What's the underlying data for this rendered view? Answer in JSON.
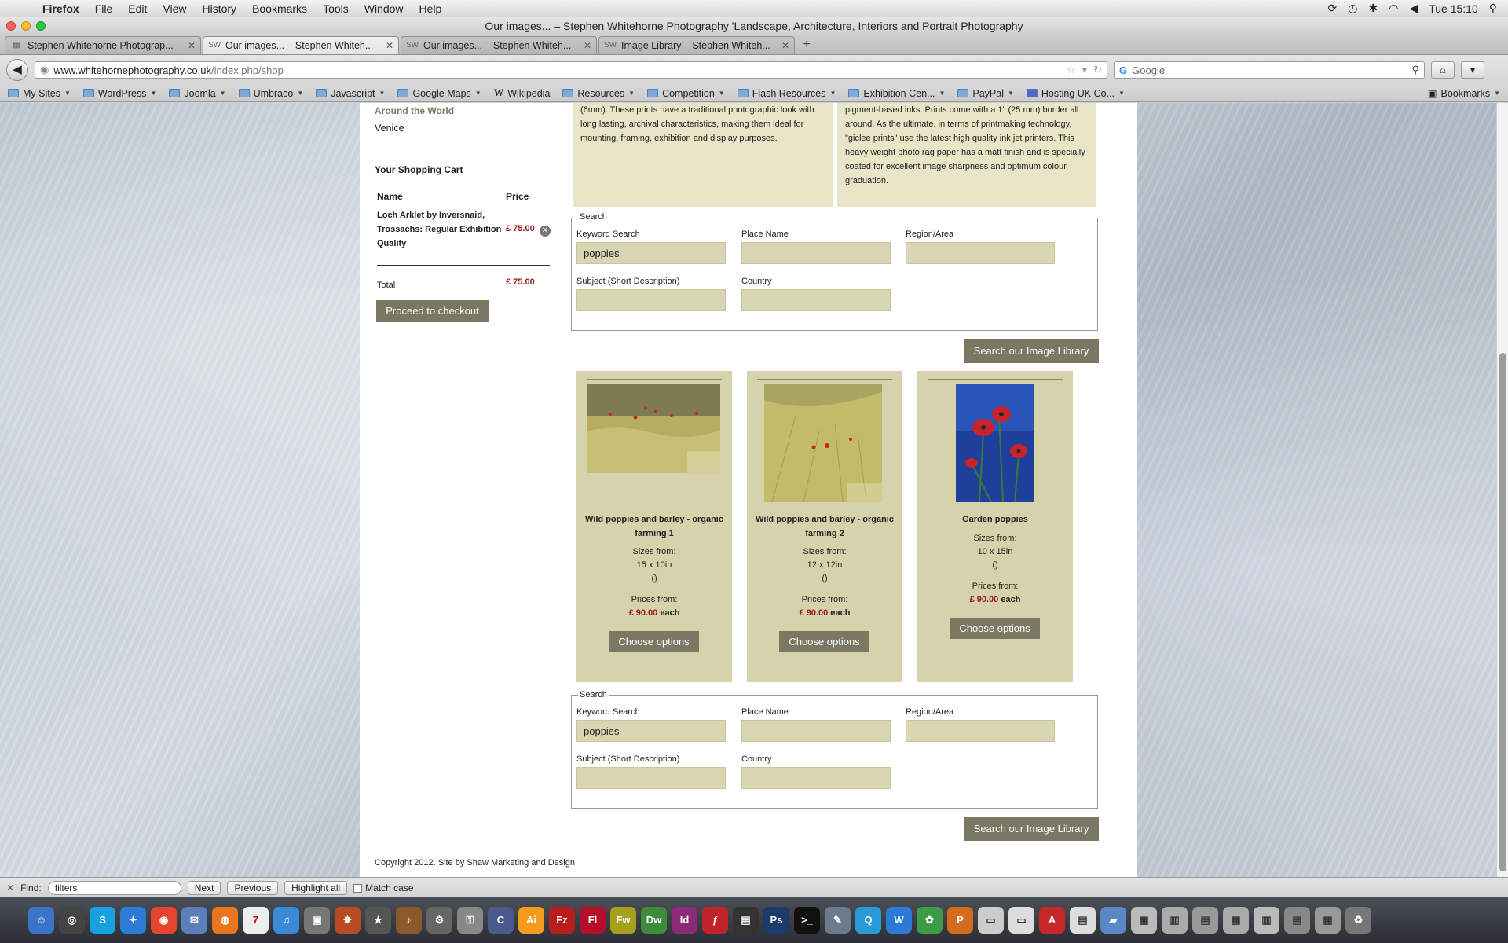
{
  "menubar": {
    "app": "Firefox",
    "items": [
      "File",
      "Edit",
      "View",
      "History",
      "Bookmarks",
      "Tools",
      "Window",
      "Help"
    ],
    "clock": "Tue 15:10"
  },
  "window": {
    "title": "Our images... – Stephen Whitehorne Photography 'Landscape, Architecture, Interiors and Portrait Photography"
  },
  "tabs": [
    {
      "label": "Stephen Whitehorne Photograp..."
    },
    {
      "label": "Our images... – Stephen Whiteh..."
    },
    {
      "label": "Our images... – Stephen Whiteh..."
    },
    {
      "label": "Image Library – Stephen Whiteh..."
    }
  ],
  "nav": {
    "url_host": "www.whitehornephotography.co.uk",
    "url_path": "/index.php/shop",
    "search_placeholder": "Google"
  },
  "bookmarks": [
    {
      "label": "My Sites"
    },
    {
      "label": "WordPress"
    },
    {
      "label": "Joomla"
    },
    {
      "label": "Umbraco"
    },
    {
      "label": "Javascript"
    },
    {
      "label": "Google Maps"
    },
    {
      "label": "Wikipedia"
    },
    {
      "label": "Resources"
    },
    {
      "label": "Competition"
    },
    {
      "label": "Flash Resources"
    },
    {
      "label": "Exhibition Cen..."
    },
    {
      "label": "PayPal"
    },
    {
      "label": "Hosting UK Co..."
    }
  ],
  "bookmarks_menu": "Bookmarks",
  "sidebar": {
    "category_link": "Around the World",
    "venice": "Venice"
  },
  "cart": {
    "title": "Your Shopping Cart",
    "col_name": "Name",
    "col_price": "Price",
    "item_name": "Loch Arklet by Inversnaid, Trossachs: Regular Exhibition Quality",
    "item_price": "£ 75.00",
    "total_label": "Total",
    "total_price": "£ 75.00",
    "checkout_label": "Proceed to checkout"
  },
  "info": {
    "left": "(6mm). These prints have a traditional photographic look with long lasting, archival characteristics, making them ideal for mounting, framing, exhibition and display purposes.",
    "right": "pigment-based inks. Prints come with a 1\" (25 mm) border all around. As the ultimate, in terms of printmaking technology, \"giclee prints\" use the latest high quality ink jet printers. This heavy weight photo rag paper has a matt finish and is specially coated for excellent image sharpness and optimum colour graduation."
  },
  "search": {
    "legend": "Search",
    "keyword_label": "Keyword Search",
    "keyword_value": "poppies",
    "place_label": "Place Name",
    "region_label": "Region/Area",
    "subject_label": "Subject (Short Description)",
    "country_label": "Country",
    "button_label": "Search our Image Library"
  },
  "products": [
    {
      "name": "Wild poppies and barley - organic farming 1",
      "sizes_label": "Sizes from:",
      "size": "15 x 10in",
      "extra": "()",
      "prices_label": "Prices from:",
      "price": "£ 90.00",
      "each": "each",
      "button": "Choose options"
    },
    {
      "name": "Wild poppies and barley - organic farming 2",
      "sizes_label": "Sizes from:",
      "size": "12 x 12in",
      "extra": "()",
      "prices_label": "Prices from:",
      "price": "£ 90.00",
      "each": "each",
      "button": "Choose options"
    },
    {
      "name": "Garden poppies",
      "sizes_label": "Sizes from:",
      "size": "10 x 15in",
      "extra": "()",
      "prices_label": "Prices from:",
      "price": "£ 90.00",
      "each": "each",
      "button": "Choose options"
    }
  ],
  "footer": {
    "copyright": "Copyright 2012. Site by Shaw Marketing and Design"
  },
  "findbar": {
    "label": "Find:",
    "value": "filters",
    "next": "Next",
    "previous": "Previous",
    "highlight": "Highlight all",
    "match_case": "Match case"
  },
  "colors": {
    "accent_button": "#7a7762",
    "price_red": "#9a1b1b",
    "panel_beige": "#e8e6c7",
    "product_bg": "#d6d2ab"
  }
}
